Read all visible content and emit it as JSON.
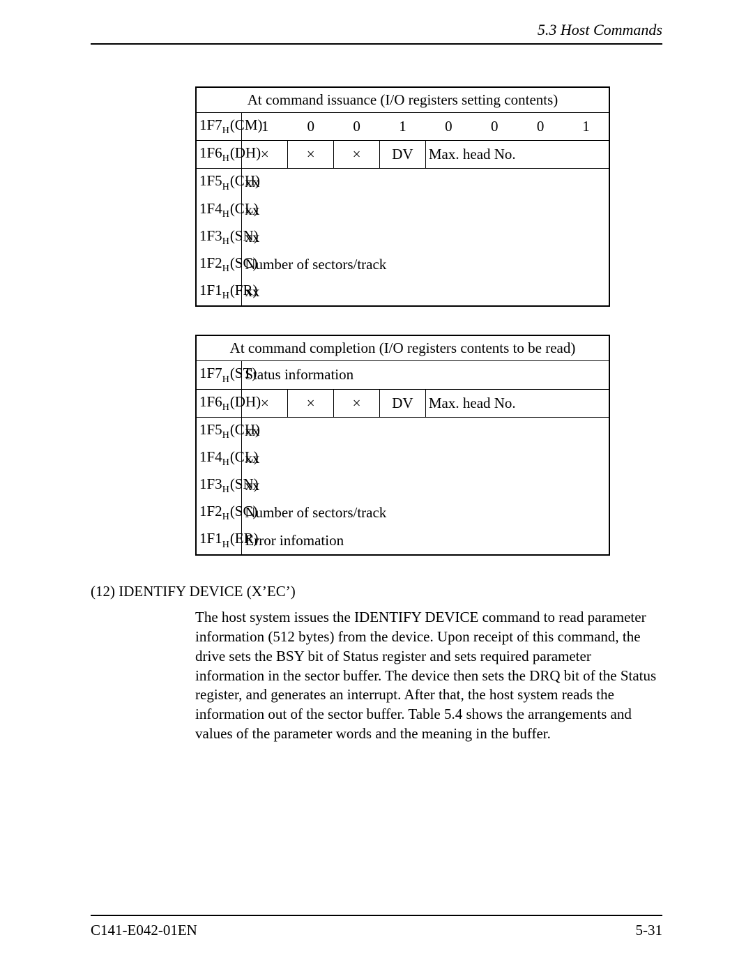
{
  "header": {
    "section": "5.3  Host Commands"
  },
  "table1": {
    "title": "At command issuance (I/O registers setting contents)",
    "rows": {
      "cm": {
        "reg": "1F7",
        "sub": "H",
        "name": "(CM)",
        "bits": [
          "1",
          "0",
          "0",
          "1",
          "0",
          "0",
          "0",
          "1"
        ]
      },
      "dh": {
        "reg": "1F6",
        "sub": "H",
        "name": "(DH)",
        "x": "×",
        "dv": "DV",
        "maxhead": "Max. head No."
      },
      "ch": {
        "reg": "1F5",
        "sub": "H",
        "name": "(CH)",
        "val": "xx"
      },
      "cl": {
        "reg": "1F4",
        "sub": "H",
        "name": "(CL)",
        "val": "xx"
      },
      "sn": {
        "reg": "1F3",
        "sub": "H",
        "name": "(SN)",
        "val": "xx"
      },
      "sc": {
        "reg": "1F2",
        "sub": "H",
        "name": "(SC)",
        "val": "Number of sectors/track"
      },
      "fr": {
        "reg": "1F1",
        "sub": "H",
        "name": "(FR)",
        "val": "xx"
      }
    }
  },
  "table2": {
    "title": "At command completion (I/O registers contents to be read)",
    "rows": {
      "st": {
        "reg": "1F7",
        "sub": "H",
        "name": "(ST)",
        "val": "Status information"
      },
      "dh": {
        "reg": "1F6",
        "sub": "H",
        "name": "(DH)",
        "x": "×",
        "dv": "DV",
        "maxhead": "Max. head No."
      },
      "ch": {
        "reg": "1F5",
        "sub": "H",
        "name": "(CH)",
        "val": "xx"
      },
      "cl": {
        "reg": "1F4",
        "sub": "H",
        "name": "(CL)",
        "val": "xx"
      },
      "sn": {
        "reg": "1F3",
        "sub": "H",
        "name": "(SN)",
        "val": "xx"
      },
      "sc": {
        "reg": "1F2",
        "sub": "H",
        "name": "(SC)",
        "val": "Number of sectors/track"
      },
      "er": {
        "reg": "1F1",
        "sub": "H",
        "name": "(ER)",
        "val": "Error infomation"
      }
    }
  },
  "section": {
    "heading": "(12)  IDENTIFY DEVICE (X’EC’)",
    "body": "The host system issues the IDENTIFY DEVICE command to read parameter information (512 bytes) from the device.  Upon receipt of this command, the drive sets the BSY bit of Status register and sets required parameter information in the sector buffer.  The device then sets the DRQ bit of the Status register, and generates an interrupt.  After that, the host system reads the information out of the sector buffer.  Table 5.4 shows the arrangements and values of the parameter words and the meaning in the buffer."
  },
  "footer": {
    "doc": "C141-E042-01EN",
    "page": "5-31"
  }
}
